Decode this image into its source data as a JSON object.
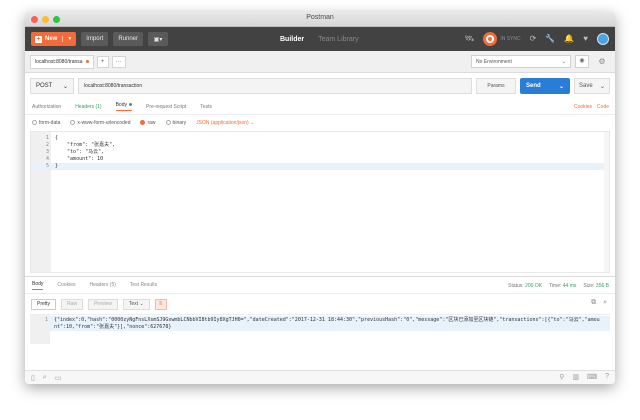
{
  "window": {
    "title": "Postman"
  },
  "toolbar": {
    "new_label": "New",
    "import_label": "Import",
    "runner_label": "Runner",
    "builder_label": "Builder",
    "team_library_label": "Team Library",
    "sync_label": "IN SYNC"
  },
  "tabs": {
    "request_tab_label": "localhost:8080/transa",
    "add_label": "+",
    "more_label": "···"
  },
  "environment": {
    "selected": "No Environment"
  },
  "request": {
    "method": "POST",
    "url": "localhost:8080/transaction",
    "params_label": "Params",
    "send_label": "Send",
    "save_label": "Save"
  },
  "request_tabs": {
    "authorization": "Authorization",
    "headers": "Headers (1)",
    "body": "Body",
    "pre_request": "Pre-request Script",
    "tests": "Tests",
    "cookies": "Cookies",
    "code": "Code"
  },
  "body_types": {
    "form_data": "form-data",
    "urlencoded": "x-www-form-urlencoded",
    "raw": "raw",
    "binary": "binary",
    "content_type": "JSON (application/json)"
  },
  "request_body": {
    "lines": [
      {
        "n": "1",
        "text": "{"
      },
      {
        "n": "2",
        "text": "    \"from\": \"张嘉夫\","
      },
      {
        "n": "3",
        "text": "    \"to\": \"马云\","
      },
      {
        "n": "4",
        "text": "    \"amount\": 10"
      },
      {
        "n": "5",
        "text": "}"
      }
    ]
  },
  "response_tabs": {
    "body": "Body",
    "cookies": "Cookies",
    "headers": "Headers (5)",
    "test_results": "Test Results"
  },
  "response_meta": {
    "status_label": "Status:",
    "status_value": "200 OK",
    "time_label": "Time:",
    "time_value": "44 ms",
    "size_label": "Size:",
    "size_value": "356 B"
  },
  "response_tools": {
    "pretty": "Pretty",
    "raw": "Raw",
    "preview": "Preview",
    "format": "Text"
  },
  "response_body": {
    "line_number": "1",
    "text": "{\"index\":0,\"hash\":\"0000zyNgFnsLXsmSJ9GxwmbLCNbbVI8tb9Iy8XgTJH0=\",\"dateCreated\":\"2017-12-31 18:44:30\",\"previousHash\":\"0\",\"message\":\"区块已添加至区块链\",\"transactions\":[{\"to\":\"马云\",\"amount\":10,\"from\":\"张嘉夫\"}],\"nonce\":627678}"
  },
  "colors": {
    "accent": "#f26b3a",
    "send_blue": "#2a7dd6",
    "status_green": "#38a169",
    "appbar": "#424242"
  }
}
